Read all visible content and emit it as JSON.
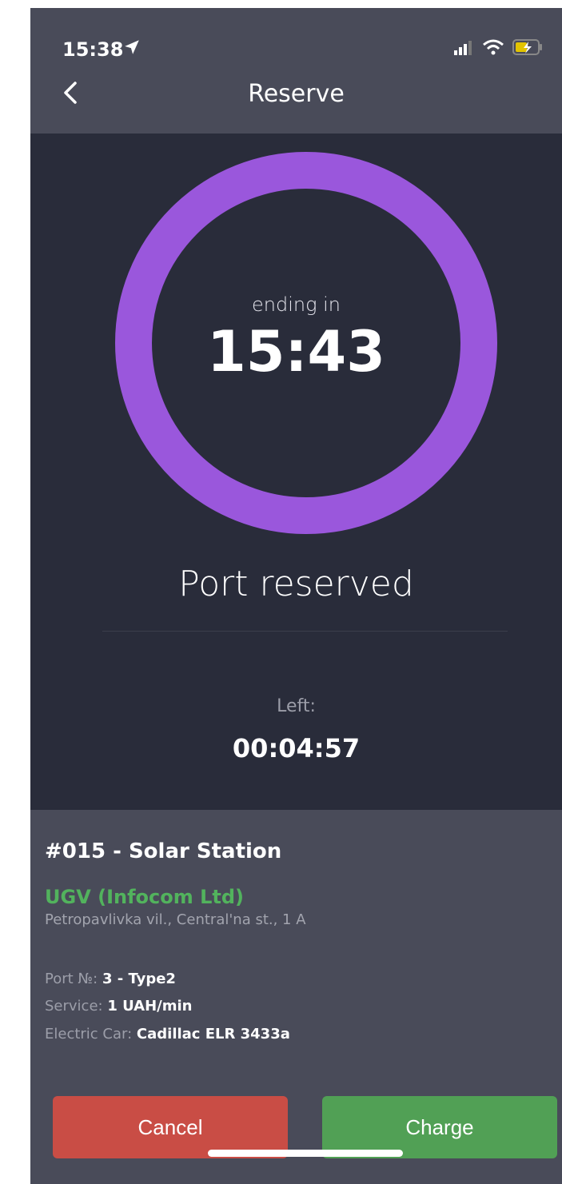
{
  "status_bar": {
    "time": "15:38"
  },
  "header": {
    "title": "Reserve"
  },
  "timer": {
    "ending_label": "ending in",
    "ending_time": "15:43",
    "status_title": "Port reserved",
    "left_label": "Left:",
    "left_value": "00:04:57"
  },
  "station": {
    "title": "#015 - Solar Station",
    "operator": "UGV (Infocom Ltd)",
    "address": "Petropavlivka vil., Central'na st., 1 A",
    "port_label": "Port №:",
    "port_value": "3 - Type2",
    "service_label": "Service:",
    "service_value": "1 UAH/min",
    "car_label": "Electric Car:",
    "car_value": "Cadillac ELR 3433a"
  },
  "actions": {
    "cancel_label": "Cancel",
    "charge_label": "Charge"
  },
  "colors": {
    "ring": "#9a57dc",
    "operator": "#52b35d",
    "cancel": "#c94d45",
    "charge": "#51a055"
  }
}
